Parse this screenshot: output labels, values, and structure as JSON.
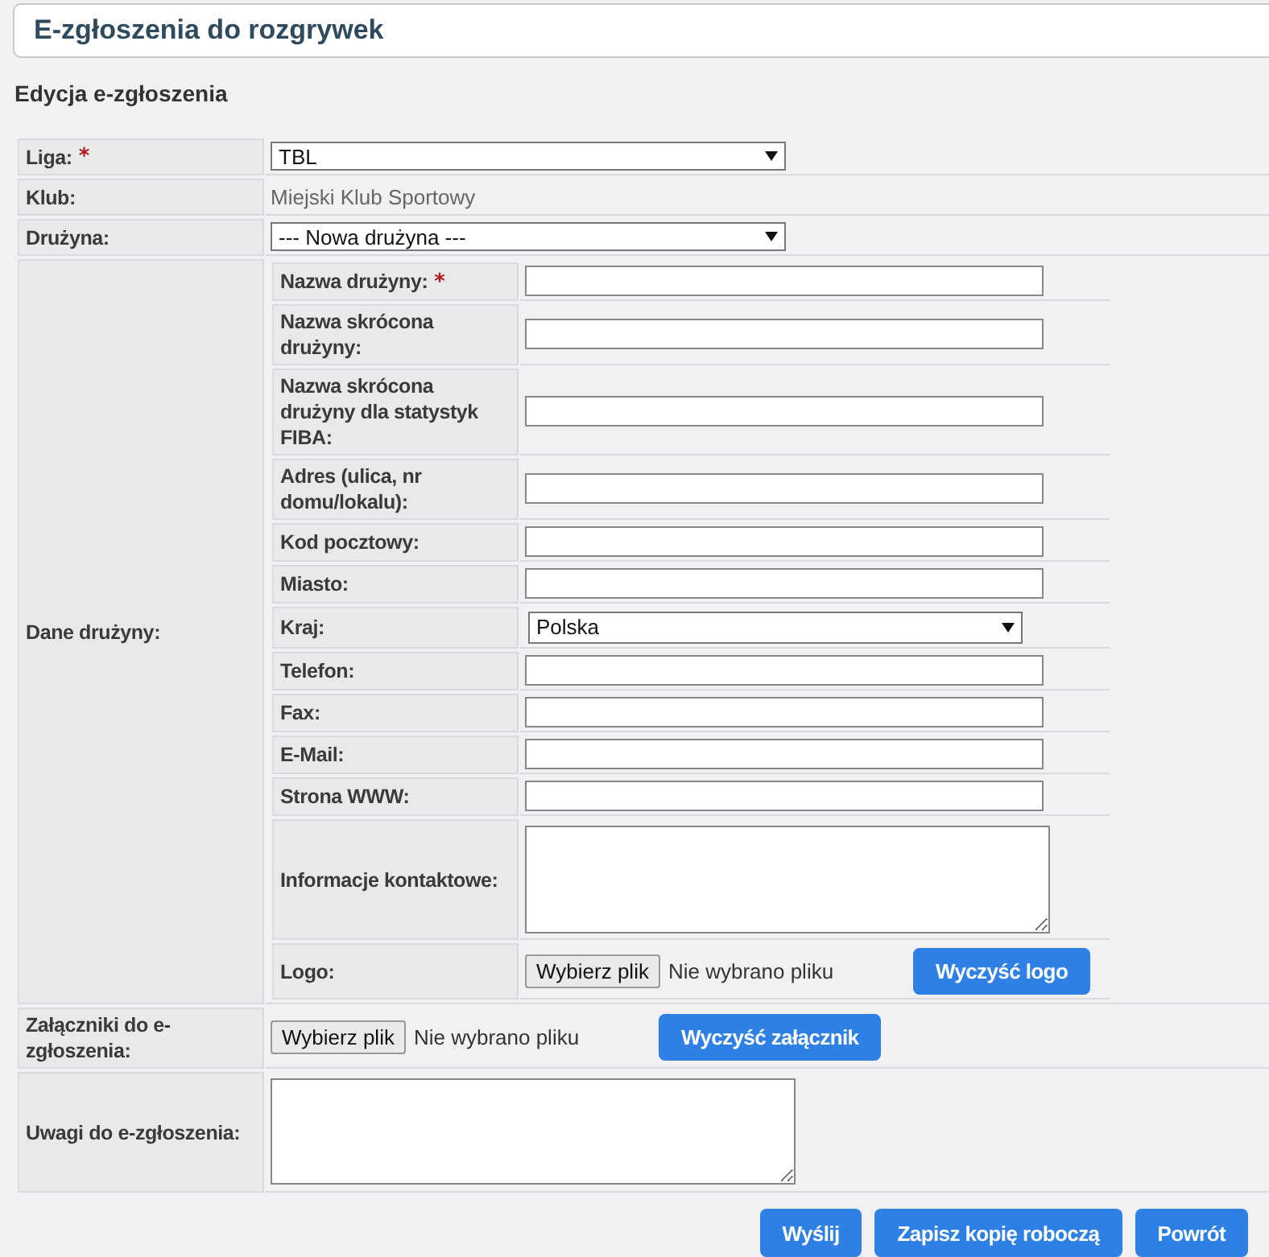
{
  "header": {
    "title": "E-zgłoszenia do rozgrywek"
  },
  "section_title": "Edycja e-zgłoszenia",
  "rows": [
    {
      "kind": "select",
      "label": "Liga:",
      "marker": "*",
      "value": "TBL"
    },
    {
      "kind": "static",
      "label": "Klub:",
      "value": "Miejski Klub Sportowy"
    },
    {
      "kind": "select",
      "label": "Drużyna:",
      "value": "--- Nowa drużyna ---"
    },
    {
      "kind": "group",
      "label": "Dane drużyny:",
      "fields": [
        {
          "kind": "text",
          "label": "Nazwa drużyny:",
          "marker": "*"
        },
        {
          "kind": "text",
          "label": "Nazwa skrócona drużyny:"
        },
        {
          "kind": "text",
          "label": "Nazwa skrócona drużyny dla statystyk FIBA:"
        },
        {
          "kind": "text",
          "label": "Adres (ulica, nr domu/lokalu):"
        },
        {
          "kind": "text",
          "label": "Kod pocztowy:"
        },
        {
          "kind": "text",
          "label": "Miasto:"
        },
        {
          "kind": "select",
          "label": "Kraj:",
          "value": "Polska"
        },
        {
          "kind": "text",
          "label": "Telefon:"
        },
        {
          "kind": "text",
          "label": "Fax:"
        },
        {
          "kind": "text",
          "label": "E-Mail:"
        },
        {
          "kind": "text",
          "label": "Strona WWW:"
        },
        {
          "kind": "textarea",
          "label": "Informacje kontaktowe:"
        },
        {
          "kind": "file",
          "label": "Logo:",
          "file_button": "Wybierz plik",
          "file_status": "Nie wybrano pliku",
          "clear_button": "Wyczyść logo"
        }
      ]
    },
    {
      "kind": "file",
      "label": "Załączniki do e-zgłoszenia:",
      "file_button": "Wybierz plik",
      "file_status": "Nie wybrano pliku",
      "clear_button": "Wyczyść załącznik"
    },
    {
      "kind": "textarea",
      "label": "Uwagi do e-zgłoszenia:"
    }
  ],
  "buttons": [
    "Wyślij",
    "Zapisz kopię roboczą",
    "Powrót"
  ]
}
